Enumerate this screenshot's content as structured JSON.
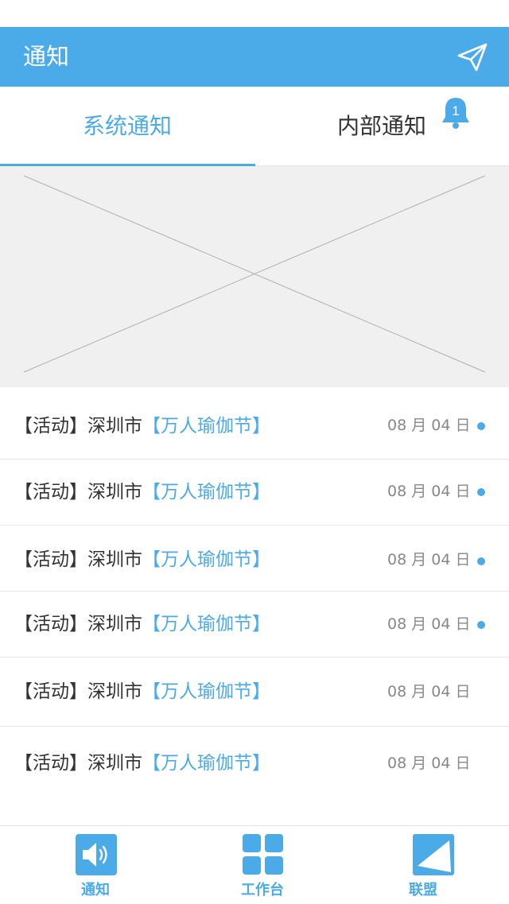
{
  "header": {
    "title": "通知",
    "send_icon": "send-paper-plane-icon"
  },
  "tabs": [
    {
      "label": "系统通知",
      "active": true
    },
    {
      "label": "内部通知",
      "active": false,
      "badge": "1"
    }
  ],
  "banner": {
    "icon": "image-placeholder-icon"
  },
  "notifications": [
    {
      "prefix": "【活动】深圳市",
      "highlight": "【万人瑜伽节】",
      "date": "08 月 04 日",
      "unread": true
    },
    {
      "prefix": "【活动】深圳市",
      "highlight": "【万人瑜伽节】",
      "date": "08 月 04 日",
      "unread": true
    },
    {
      "prefix": "【活动】深圳市",
      "highlight": "【万人瑜伽节】",
      "date": "08 月 04 日",
      "unread": true
    },
    {
      "prefix": "【活动】深圳市",
      "highlight": "【万人瑜伽节】",
      "date": "08 月 04 日",
      "unread": true
    },
    {
      "prefix": "【活动】深圳市",
      "highlight": "【万人瑜伽节】",
      "date": "08 月 04 日",
      "unread": false
    },
    {
      "prefix": "【活动】深圳市",
      "highlight": "【万人瑜伽节】",
      "date": "08 月 04 日",
      "unread": false
    }
  ],
  "bottom_nav": [
    {
      "label": "通知",
      "icon": "speaker-icon"
    },
    {
      "label": "工作台",
      "icon": "grid-icon"
    },
    {
      "label": "联盟",
      "icon": "triangle-icon"
    }
  ],
  "colors": {
    "accent": "#4aabe8",
    "text": "#333333",
    "muted": "#888888",
    "banner_bg": "#f0f0f0"
  }
}
